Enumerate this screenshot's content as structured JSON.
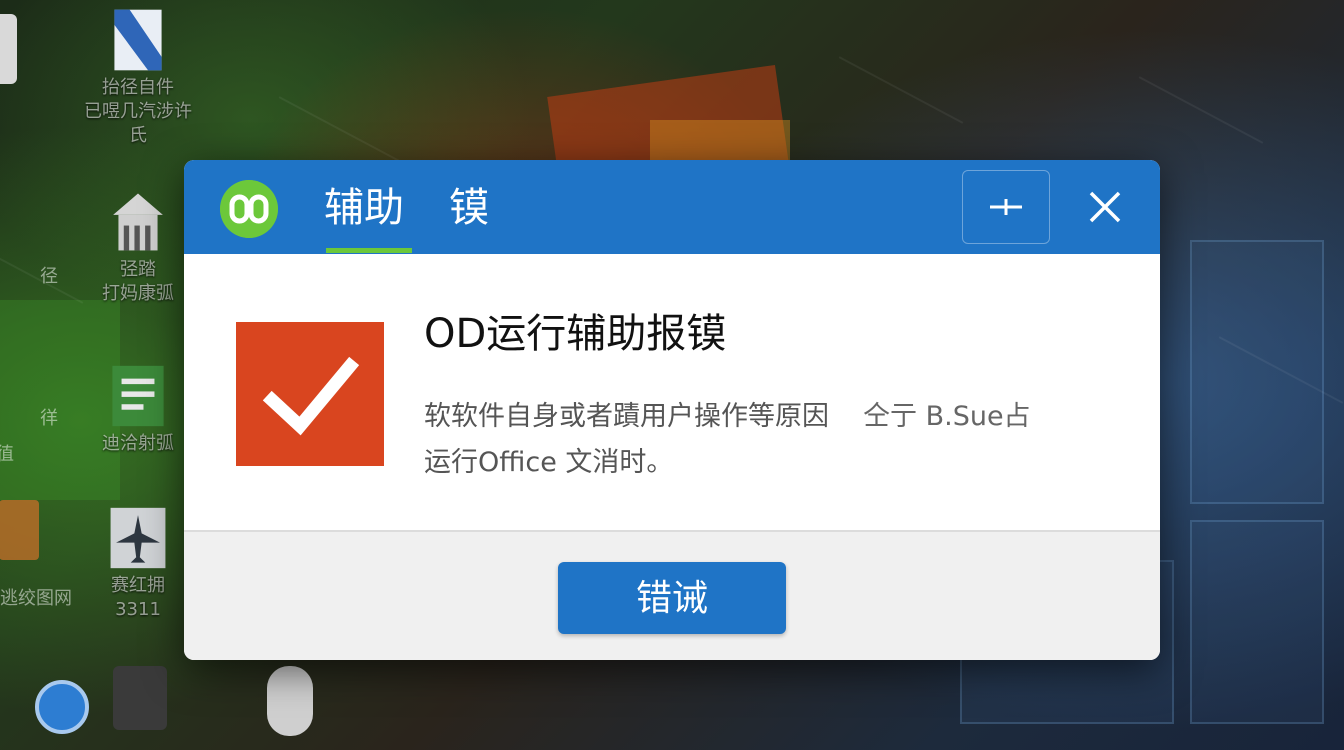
{
  "desktop": {
    "icons": [
      {
        "name": "document-icon",
        "label": "抬径自件\n已喅几汽涉许氏"
      },
      {
        "name": "house-icon",
        "label": "弪踏\n打妈康弧"
      },
      {
        "name": "notes-icon",
        "label": "迪洽射弧"
      },
      {
        "name": "airplane-icon",
        "label": "赛红拥\n3311"
      }
    ],
    "side_labels": [
      "径",
      "徉",
      "徝",
      "逃绞图网"
    ]
  },
  "dialog": {
    "tab_title": "辅助",
    "tab_title_2": "镆",
    "message_title": "OD运行辅助报镆",
    "message_line1": "软软件自身或者蹟用户操作等原因",
    "message_garbled": "仝亍 B.Sue占",
    "message_line2": "运行Office 文消时。",
    "action_label": "错诫"
  },
  "colors": {
    "titlebar": "#1f74c6",
    "accent_green": "#6cc83a",
    "check_tile": "#d9451f",
    "button": "#1f74c6"
  }
}
